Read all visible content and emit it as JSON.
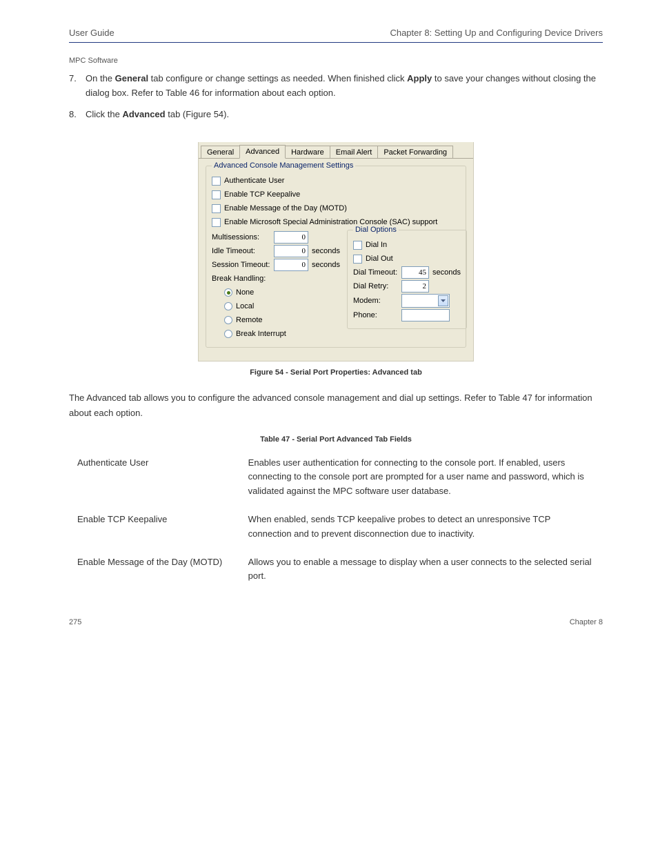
{
  "header": {
    "left": "User Guide",
    "right": "Chapter 8: Setting Up and Configuring Device Drivers"
  },
  "doc_title": "MPC Software",
  "steps": {
    "s7": {
      "num": "7.",
      "text_a": "On the ",
      "bold": "General",
      "text_b": " tab configure or change settings as needed. When finished click ",
      "bold_b": "Apply",
      "text_c": " to save your changes without closing the dialog box. Refer to Table 46 for information about each option."
    },
    "s8": {
      "num": "8.",
      "text_a": "Click the ",
      "bold": "Advanced",
      "text_b": " tab (Figure 54)."
    }
  },
  "panel": {
    "tabs": [
      "General",
      "Advanced",
      "Hardware",
      "Email Alert",
      "Packet Forwarding"
    ],
    "group_label": "Advanced Console Management Settings",
    "cb_auth": "Authenticate User",
    "cb_keep": "Enable TCP Keepalive",
    "cb_motd": "Enable Message of the Day (MOTD)",
    "cb_sac": "Enable Microsoft Special Administration Console (SAC) support",
    "multisessions_label": "Multisessions:",
    "multisessions_value": "0",
    "idle_label": "Idle Timeout:",
    "idle_value": "0",
    "session_label": "Session Timeout:",
    "session_value": "0",
    "seconds": "seconds",
    "break_label": "Break Handling:",
    "rb_none": "None",
    "rb_local": "Local",
    "rb_remote": "Remote",
    "rb_breakint": "Break Interrupt",
    "dial_group": "Dial Options",
    "dial_in": "Dial In",
    "dial_out": "Dial Out",
    "dial_timeout": "Dial Timeout:",
    "dial_timeout_value": "45",
    "dial_retry": "Dial Retry:",
    "dial_retry_value": "2",
    "modem": "Modem:",
    "phone": "Phone:"
  },
  "figure_caption": "Figure 54 - Serial Port Properties: Advanced tab",
  "body_after": "The Advanced tab allows you to configure the advanced console management and dial up settings. Refer to Table 47 for information about each option.",
  "table": {
    "title": "Table 47 - Serial Port Advanced Tab Fields",
    "rows": [
      {
        "f": "Authenticate User",
        "d": "Enables user authentication for connecting to the console port. If enabled, users connecting to the console port are prompted for a user name and password, which is validated against the MPC software user database."
      },
      {
        "f": "Enable TCP Keepalive",
        "d": "When enabled, sends TCP keepalive probes to detect an unresponsive TCP connection and to prevent disconnection due to inactivity."
      },
      {
        "f": "Enable Message of the Day (MOTD)",
        "d": "Allows you to enable a message to display when a user connects to the selected serial port."
      }
    ]
  },
  "footer": {
    "left": "275",
    "right": "Chapter 8"
  }
}
